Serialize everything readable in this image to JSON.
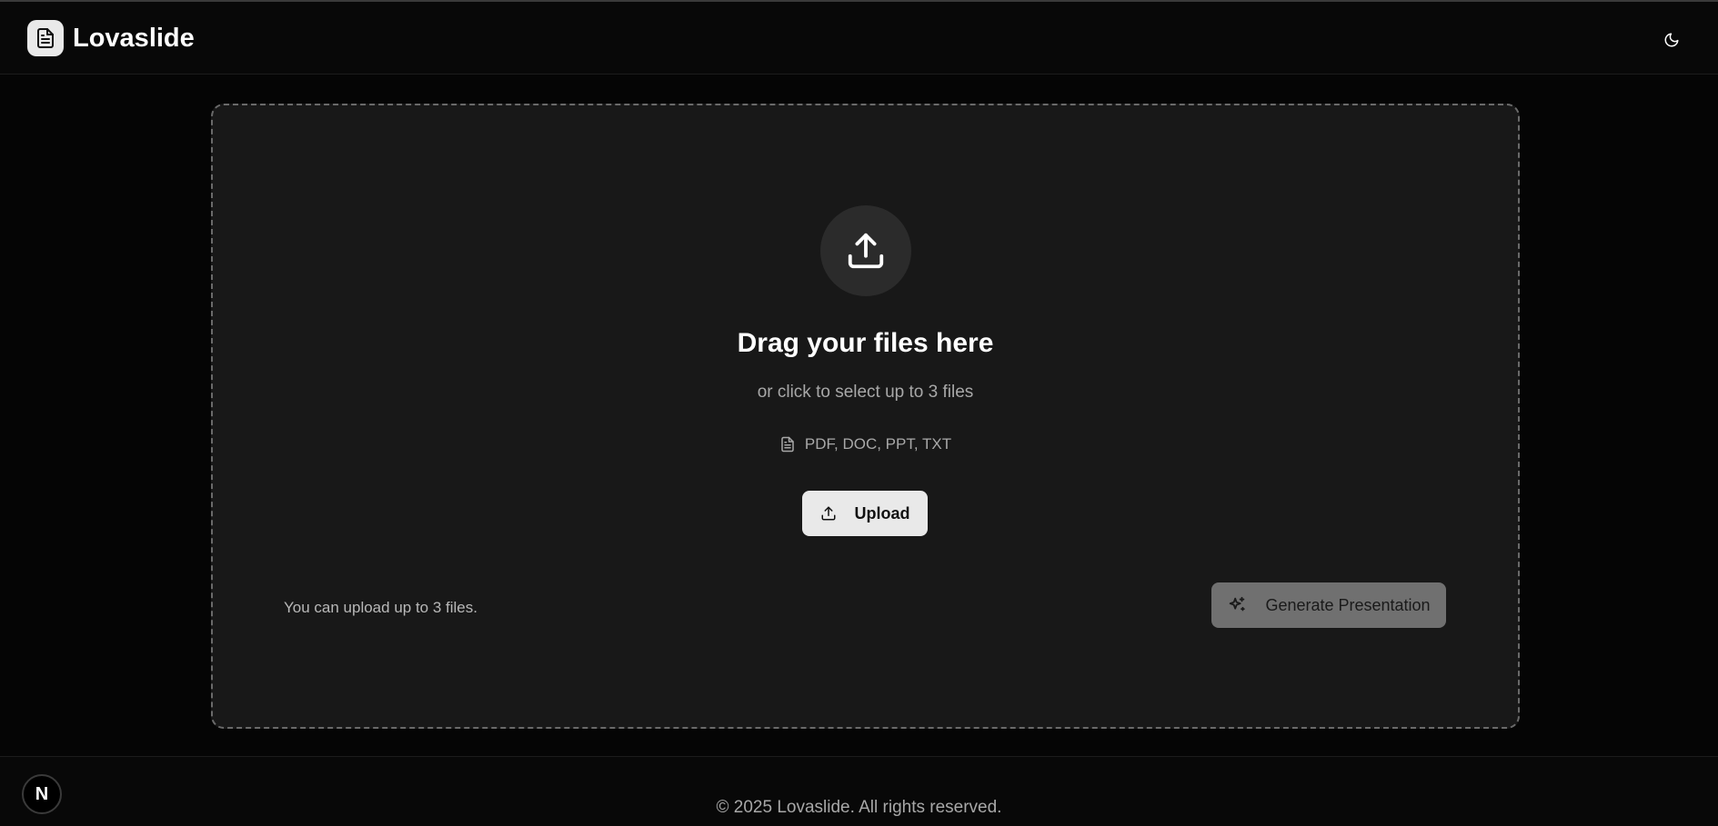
{
  "header": {
    "brand": "Lovaslide",
    "logo_icon": "document-icon",
    "theme_toggle_icon": "moon-icon"
  },
  "dropzone": {
    "upload_icon": "upload-icon",
    "title": "Drag your files here",
    "subtitle": "or click to select up to 3 files",
    "formats_icon": "document-icon",
    "formats": "PDF, DOC, PPT, TXT",
    "upload_button_label": "Upload",
    "limit_note": "You can upload up to 3 files.",
    "generate_button_label": "Generate Presentation",
    "generate_icon": "sparkles-icon"
  },
  "footer": {
    "copyright": "© 2025 Lovaslide. All rights reserved."
  },
  "badge": {
    "label": "N"
  },
  "colors": {
    "background": "#050505",
    "panel": "#181818",
    "upload_button": "#e9e9e9",
    "generate_button": "#707070"
  }
}
